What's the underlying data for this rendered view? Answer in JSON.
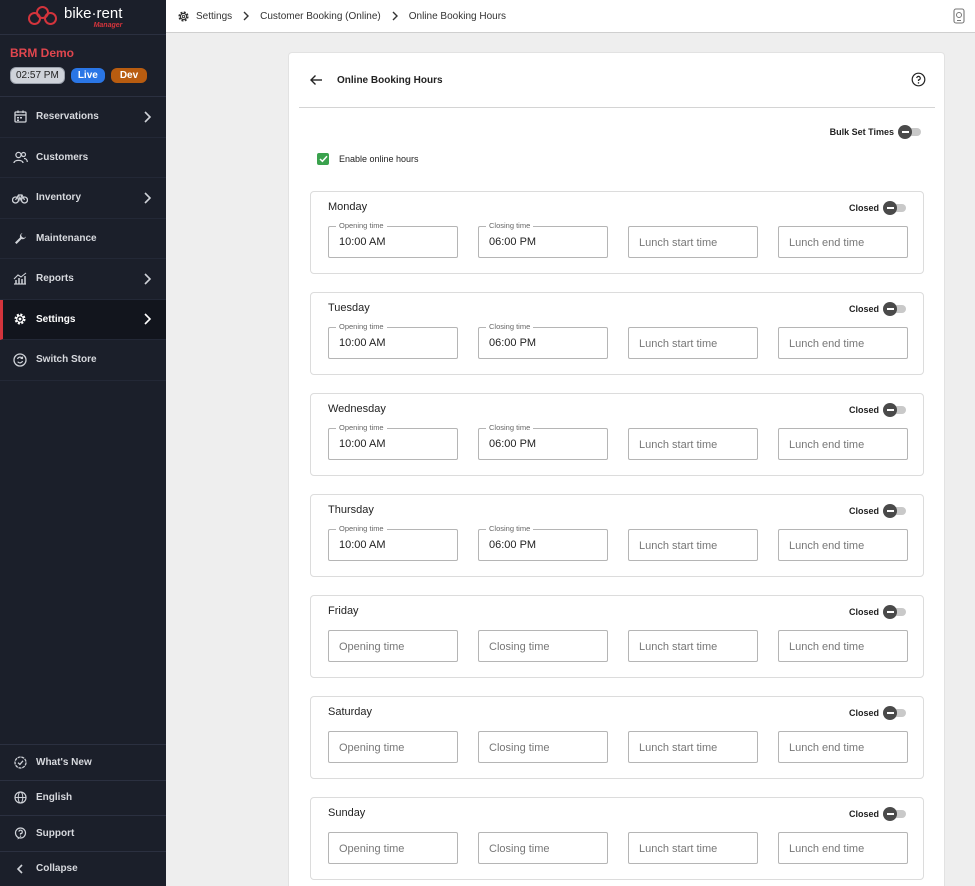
{
  "app": {
    "brand_main": "bike·rent",
    "brand_sub": "Manager"
  },
  "store": {
    "name": "BRM Demo",
    "time": "02:57 PM",
    "live_badge": "Live",
    "dev_badge": "Dev"
  },
  "nav": {
    "items": [
      {
        "label": "Reservations",
        "icon": "calendar-icon",
        "has_chevron": true
      },
      {
        "label": "Customers",
        "icon": "users-icon",
        "has_chevron": false
      },
      {
        "label": "Inventory",
        "icon": "bike-icon",
        "has_chevron": true
      },
      {
        "label": "Maintenance",
        "icon": "wrench-icon",
        "has_chevron": false
      },
      {
        "label": "Reports",
        "icon": "chart-icon",
        "has_chevron": true
      },
      {
        "label": "Settings",
        "icon": "gear-icon",
        "has_chevron": true,
        "active": true
      },
      {
        "label": "Switch Store",
        "icon": "switch-icon",
        "has_chevron": false
      }
    ],
    "bottom": [
      {
        "label": "What's New",
        "icon": "badge-check-icon"
      },
      {
        "label": "English",
        "icon": "globe-icon"
      },
      {
        "label": "Support",
        "icon": "help-icon"
      },
      {
        "label": "Collapse",
        "icon": "chevron-left-icon"
      }
    ]
  },
  "breadcrumb": [
    "Settings",
    "Customer Booking (Online)",
    "Online Booking Hours"
  ],
  "page": {
    "title": "Online Booking Hours",
    "bulk_label": "Bulk Set Times",
    "enable_label": "Enable online hours",
    "enable_checked": true,
    "closed_label": "Closed"
  },
  "fields": {
    "opening_label": "Opening time",
    "closing_label": "Closing time",
    "lunch_start_placeholder": "Lunch start time",
    "lunch_end_placeholder": "Lunch end time"
  },
  "days": [
    {
      "name": "Monday",
      "opening": "10:00 AM",
      "closing": "06:00 PM"
    },
    {
      "name": "Tuesday",
      "opening": "10:00 AM",
      "closing": "06:00 PM"
    },
    {
      "name": "Wednesday",
      "opening": "10:00 AM",
      "closing": "06:00 PM"
    },
    {
      "name": "Thursday",
      "opening": "10:00 AM",
      "closing": "06:00 PM"
    },
    {
      "name": "Friday",
      "opening": "",
      "closing": ""
    },
    {
      "name": "Saturday",
      "opening": "",
      "closing": ""
    },
    {
      "name": "Sunday",
      "opening": "",
      "closing": ""
    }
  ],
  "colors": {
    "sidebar_bg": "#1b1f2a",
    "accent_red": "#d3343c",
    "live_blue": "#2a76e6",
    "dev_orange": "#b85c10",
    "check_green": "#3aa24d"
  }
}
